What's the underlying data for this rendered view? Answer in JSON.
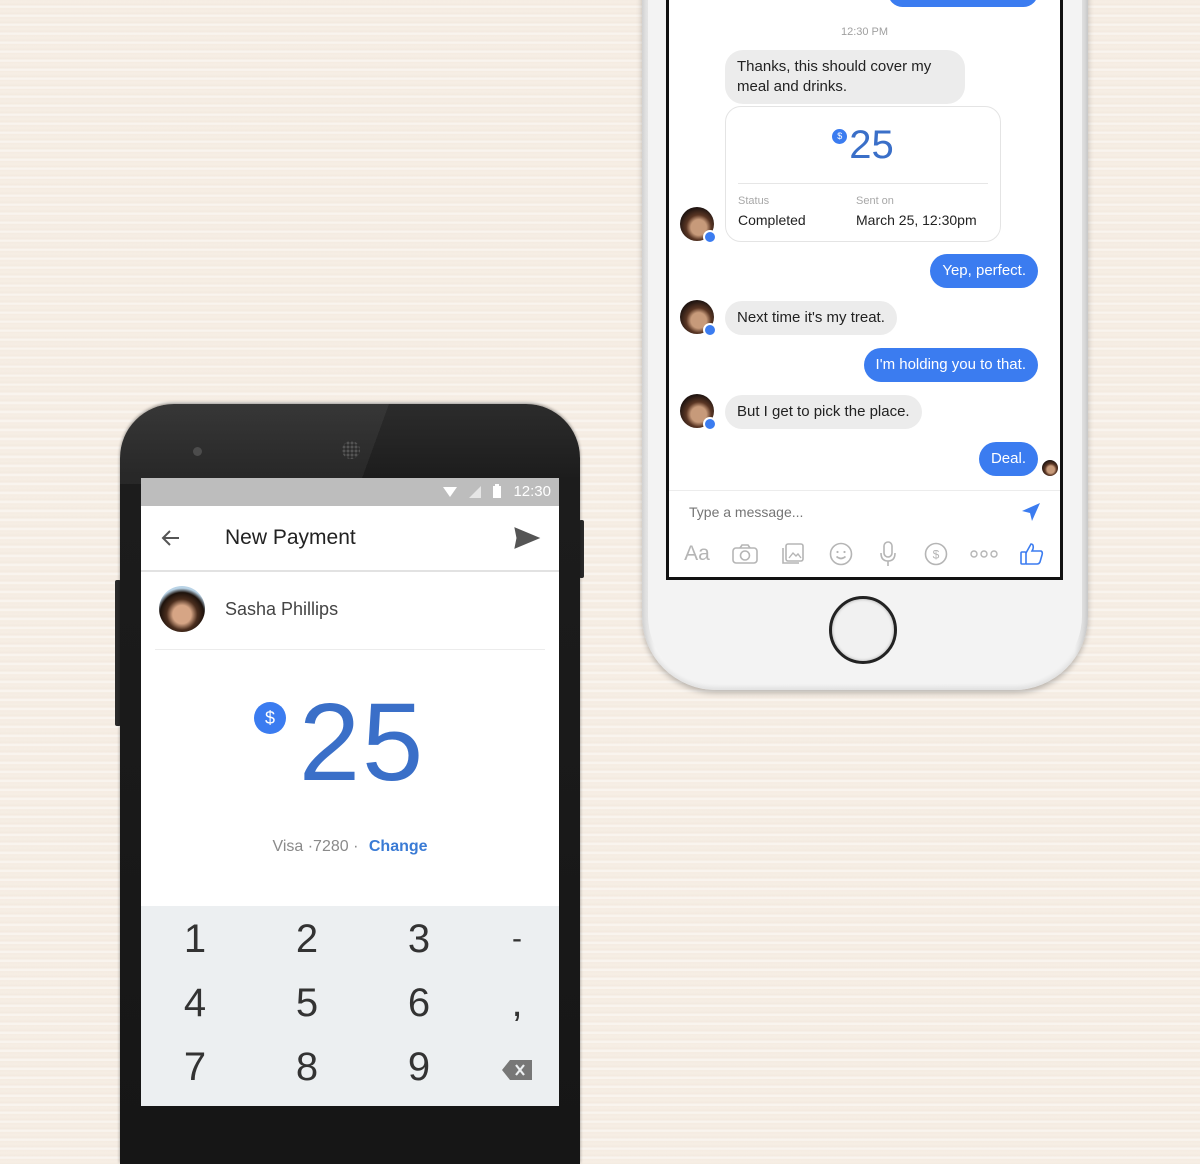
{
  "messenger": {
    "timestamp": "12:30 PM",
    "messages": [
      {
        "from": "them",
        "text": "Thanks, this should cover my meal and drinks."
      },
      {
        "from": "me",
        "text": "Yep, perfect."
      },
      {
        "from": "them",
        "text": "Next time it's my treat."
      },
      {
        "from": "me",
        "text": "I'm holding you to that."
      },
      {
        "from": "them",
        "text": "But I get to pick the place."
      },
      {
        "from": "me",
        "text": "Deal."
      }
    ],
    "payment_card": {
      "currency_symbol": "$",
      "amount": "25",
      "status_label": "Status",
      "status_value": "Completed",
      "sent_label": "Sent on",
      "sent_value": "March 25, 12:30pm"
    },
    "composer": {
      "placeholder": "Type a message...",
      "toolbar": [
        {
          "icon": "text-format-icon",
          "glyph": "Aa"
        },
        {
          "icon": "camera-icon",
          "glyph": ""
        },
        {
          "icon": "gallery-icon",
          "glyph": ""
        },
        {
          "icon": "emoji-icon",
          "glyph": "☺"
        },
        {
          "icon": "microphone-icon",
          "glyph": ""
        },
        {
          "icon": "payment-icon",
          "glyph": "$"
        },
        {
          "icon": "more-icon",
          "glyph": "∘∘∘"
        },
        {
          "icon": "like-icon",
          "glyph": ""
        }
      ]
    },
    "accent_color": "#3b7cf0"
  },
  "android": {
    "status_time": "12:30",
    "title": "New Payment",
    "recipient_name": "Sasha Phillips",
    "currency_symbol": "$",
    "amount": "25",
    "card_text": "Visa ·7280 ·",
    "change_label": "Change",
    "keypad": [
      "1",
      "2",
      "3",
      "-",
      "4",
      "5",
      "6",
      ",",
      "7",
      "8",
      "9",
      "⌫"
    ]
  }
}
